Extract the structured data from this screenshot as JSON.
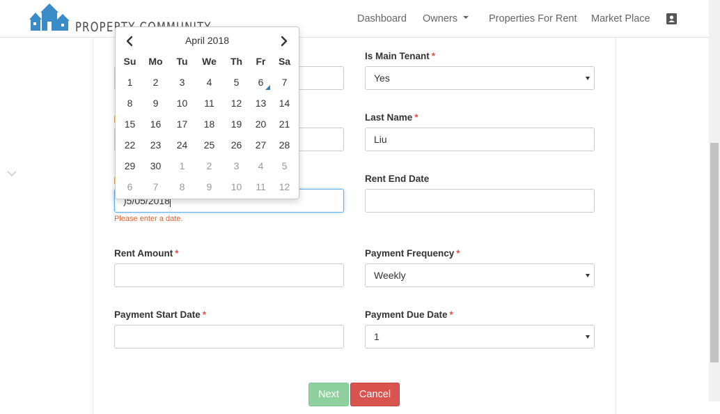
{
  "brand": {
    "name": "PROPERTY COMMUNITY",
    "logo_icon": "houses-logo-icon"
  },
  "nav": {
    "dashboard": "Dashboard",
    "owners": "Owners",
    "properties_for_rent": "Properties For Rent",
    "market_place": "Market Place",
    "user_icon": "contact-card-icon"
  },
  "form": {
    "is_main_tenant": {
      "label": "Is Main Tenant",
      "value": "Yes"
    },
    "last_name": {
      "label": "Last Name",
      "value": "Liu"
    },
    "rent_start_date": {
      "value": "05/05/2018",
      "visible_value": ")5/05/2018",
      "error": "Please enter a date."
    },
    "rent_end_date": {
      "label": "Rent End Date",
      "value": ""
    },
    "rent_amount": {
      "label": "Rent Amount",
      "value": ""
    },
    "payment_frequency": {
      "label": "Payment Frequency",
      "value": "Weekly"
    },
    "payment_start_date": {
      "label": "Payment Start Date",
      "value": ""
    },
    "payment_due_date": {
      "label": "Payment Due Date",
      "value": "1"
    },
    "required_marker": "*"
  },
  "buttons": {
    "next": "Next",
    "cancel": "Cancel"
  },
  "datepicker": {
    "month_title": "April 2018",
    "weekdays": [
      "Su",
      "Mo",
      "Tu",
      "We",
      "Th",
      "Fr",
      "Sa"
    ],
    "weeks": [
      [
        "1",
        "2",
        "3",
        "4",
        "5",
        "6",
        "7"
      ],
      [
        "8",
        "9",
        "10",
        "11",
        "12",
        "13",
        "14"
      ],
      [
        "15",
        "16",
        "17",
        "18",
        "19",
        "20",
        "21"
      ],
      [
        "22",
        "23",
        "24",
        "25",
        "26",
        "27",
        "28"
      ],
      [
        "29",
        "30",
        "1",
        "2",
        "3",
        "4",
        "5"
      ],
      [
        "6",
        "7",
        "8",
        "9",
        "10",
        "11",
        "12"
      ]
    ],
    "today": "6",
    "prev_icon": "chevron-left-icon",
    "next_icon": "chevron-right-icon"
  },
  "colors": {
    "brand_blue": "#3a8cc8",
    "required_red": "#d9534f",
    "error_orange": "#e2612b",
    "next_green": "#8fd19e",
    "cancel_red": "#d9534f",
    "focus_blue": "#66afe9"
  }
}
